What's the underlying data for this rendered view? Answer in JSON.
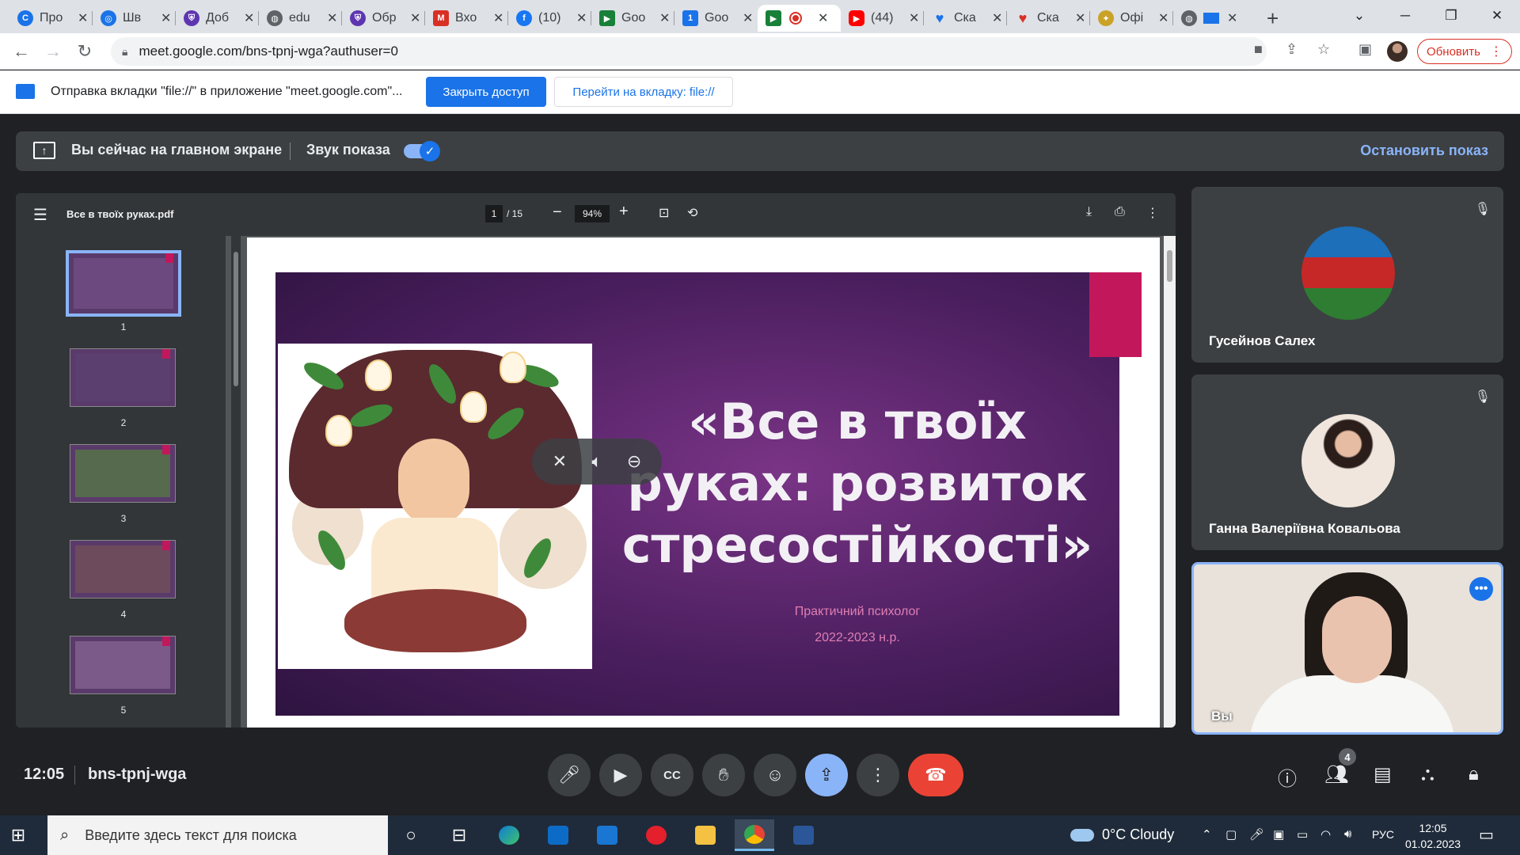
{
  "browser": {
    "tabs": [
      {
        "title": "Про",
        "icon": "chrome-icon",
        "color": "#1a73e8"
      },
      {
        "title": "Шв",
        "icon": "app-icon",
        "color": "#1a73e8"
      },
      {
        "title": "Доб",
        "icon": "shield-icon",
        "color": "#5e35b1"
      },
      {
        "title": "edu",
        "icon": "globe-icon",
        "color": "#5f6368"
      },
      {
        "title": "Обр",
        "icon": "shield-icon",
        "color": "#5e35b1"
      },
      {
        "title": "Вхо",
        "icon": "gmail-icon",
        "color": "#d93025"
      },
      {
        "title": "(10)",
        "icon": "facebook-icon",
        "color": "#1877f2"
      },
      {
        "title": "Goo",
        "icon": "meet-icon",
        "color": "#188038"
      },
      {
        "title": "Goo",
        "icon": "docs-icon",
        "color": "#1a73e8"
      },
      {
        "title": "",
        "icon": "meet-icon",
        "color": "#188038",
        "active": true
      },
      {
        "title": "(44)",
        "icon": "youtube-icon",
        "color": "#ff0000"
      },
      {
        "title": "Ска",
        "icon": "heart-icon",
        "color": "#1a73e8"
      },
      {
        "title": "Ска",
        "icon": "heart-icon",
        "color": "#d93025"
      },
      {
        "title": "Офі",
        "icon": "emblem-icon",
        "color": "#c9a227"
      },
      {
        "title": "",
        "icon": "globe-icon",
        "color": "#5f6368"
      }
    ],
    "url": "meet.google.com/bns-tpnj-wga?authuser=0",
    "update_label": "Обновить"
  },
  "infobar": {
    "message": "Отправка вкладки \"file://\" в приложение \"meet.google.com\"...",
    "stop_access": "Закрыть доступ",
    "goto_tab": "Перейти на вкладку: file://"
  },
  "present_bar": {
    "main_screen": "Вы сейчас на главном экране",
    "sound": "Звук показа",
    "sound_on": true,
    "stop": "Остановить показ"
  },
  "pdf": {
    "filename": "Все в твоїх руках.pdf",
    "page": "1",
    "total": "/ 15",
    "zoom": "94%",
    "thumbs": [
      "1",
      "2",
      "3",
      "4",
      "5"
    ],
    "slide": {
      "title": "«Все в твоїх руках: розвиток стресостійкості»",
      "subtitle1": "Практичний психолог",
      "subtitle2": "2022-2023 н.р."
    }
  },
  "participants": [
    {
      "name": "Гусейнов Салех",
      "muted": true
    },
    {
      "name": "Ганна Валеріївна Ковальова",
      "muted": true
    },
    {
      "name": "Вы",
      "muted": false
    }
  ],
  "meeting": {
    "time": "12:05",
    "code": "bns-tpnj-wga",
    "people_count": "4"
  },
  "taskbar": {
    "search_placeholder": "Введите здесь текст для поиска",
    "weather": "0°C  Cloudy",
    "lang": "РУС",
    "time": "12:05",
    "date": "01.02.2023"
  }
}
